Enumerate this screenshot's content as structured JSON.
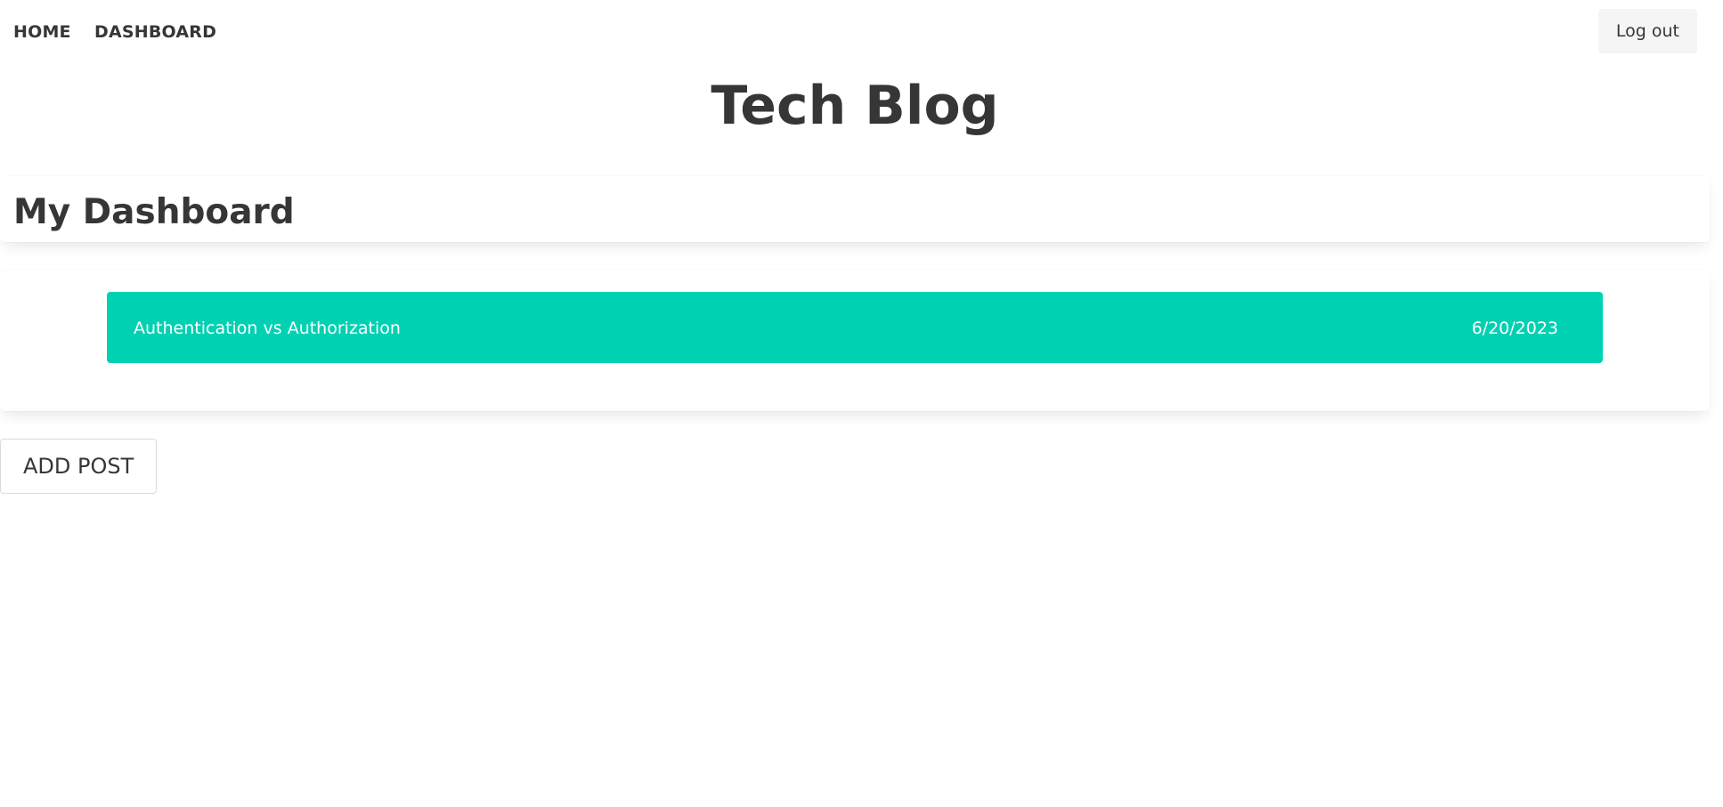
{
  "nav": {
    "home_label": "HOME",
    "dashboard_label": "DASHBOARD",
    "logout_label": "Log out"
  },
  "site": {
    "title": "Tech Blog"
  },
  "dashboard": {
    "heading": "My Dashboard",
    "posts": [
      {
        "title": "Authentication vs Authorization",
        "date": "6/20/2023"
      }
    ],
    "add_post_label": "ADD POST"
  },
  "colors": {
    "accent": "#00d1b2",
    "text": "#363636",
    "button_light": "#f5f5f5"
  }
}
